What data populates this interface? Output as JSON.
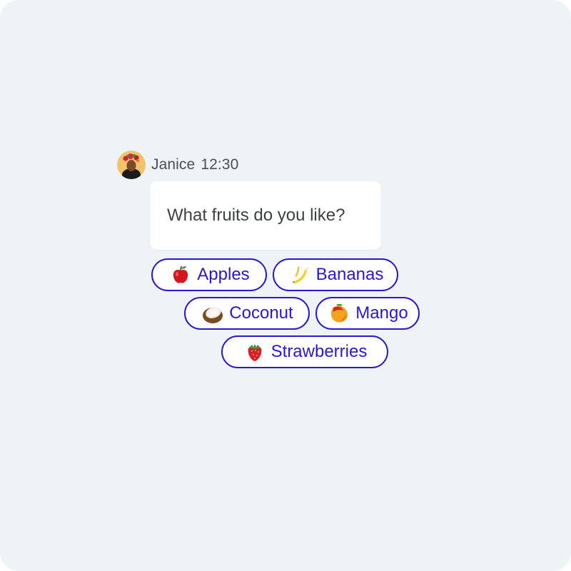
{
  "message": {
    "sender": "Janice",
    "time": "12:30",
    "text": "What fruits do you like?"
  },
  "options": [
    {
      "label": "Apples",
      "icon": "apple-icon"
    },
    {
      "label": "Bananas",
      "icon": "banana-icon"
    },
    {
      "label": "Coconut",
      "icon": "coconut-icon"
    },
    {
      "label": "Mango",
      "icon": "mango-icon"
    },
    {
      "label": "Strawberries",
      "icon": "strawberry-icon"
    }
  ],
  "colors": {
    "background": "#eef3f6",
    "accent": "#2a16d6",
    "bubble": "#ffffff",
    "text": "#3d4147"
  }
}
